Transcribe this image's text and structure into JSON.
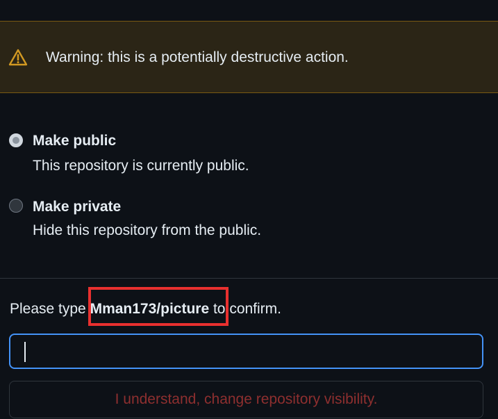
{
  "warning": {
    "icon": "alert-triangle-icon",
    "text": "Warning: this is a potentially destructive action."
  },
  "options": [
    {
      "title": "Make public",
      "description": "This repository is currently public.",
      "selected": true
    },
    {
      "title": "Make private",
      "description": "Hide this repository from the public.",
      "selected": false
    }
  ],
  "confirm": {
    "prefix": "Please type ",
    "repo": "Mman173/picture",
    "suffix": " to confirm.",
    "input_value": "",
    "button_label": "I understand, change repository visibility."
  },
  "colors": {
    "background": "#0d1117",
    "warning_background": "#2b2516",
    "warning_border": "#7a5a12",
    "warning_icon": "#d29922",
    "input_focus": "#4493f8",
    "danger_text": "#8e2f2f",
    "highlight": "#e8302f"
  }
}
